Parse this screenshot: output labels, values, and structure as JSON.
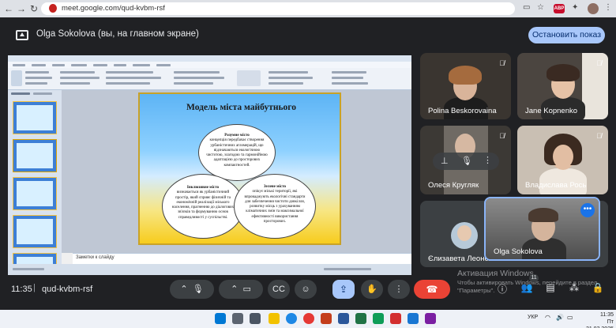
{
  "browser": {
    "url": "meet.google.com/qud-kvbm-rsf",
    "abp_label": "ABP"
  },
  "banner": {
    "text": "Olga Sokolova (вы, на главном экране)",
    "stop_button": "Остановить показ"
  },
  "presentation": {
    "notes_placeholder": "Заметки к слайду",
    "slide": {
      "title": "Модель міста майбутнього",
      "smart_city_heading": "Розумне місто",
      "smart_city_text": "концепція передбачає створення урбаністичних агломерацій, що відзначаються екологічною чистотою, злагодою та гармонійною адаптацією до просторових компактностей.",
      "inclusive_city_heading": "Інклюзивне місто",
      "inclusive_city_text": "визначається як урбаністичний простір, який сприяє фізичній та економічній реалізації міського населення, прагненню до діалогових зв'язків та формуванню основ справедливості у суспільстві.",
      "green_city_heading": "Зелене місто",
      "green_city_text": "опікує міські території, які впроваджують екологічні стандарти для забезпечення чистоти довкілля, розвитку місць з урахуванням кліматичних змін та максимальної ефективності використання просторових."
    }
  },
  "participants": [
    {
      "name": "Polina Beskorovaina",
      "muted": true
    },
    {
      "name": "Jane Kopnenko",
      "muted": true
    },
    {
      "name": "Олеся Кругляк",
      "muted": true
    },
    {
      "name": "Владислава Рось",
      "muted": true
    },
    {
      "name": "Єлизавета Леонєва",
      "muted": true
    },
    {
      "name": "Olga Sokolova",
      "muted": false
    }
  ],
  "bottom_bar": {
    "time": "11:35",
    "meeting_code": "qud-kvbm-rsf",
    "people_count": "11"
  },
  "windows_watermark": {
    "title": "Активация Windows",
    "subtitle": "Чтобы активировать Windows, перейдите в раздел \"Параметры\"."
  },
  "taskbar": {
    "language": "УКР",
    "time": "11:35",
    "date": "Пт 31.03.2025"
  }
}
